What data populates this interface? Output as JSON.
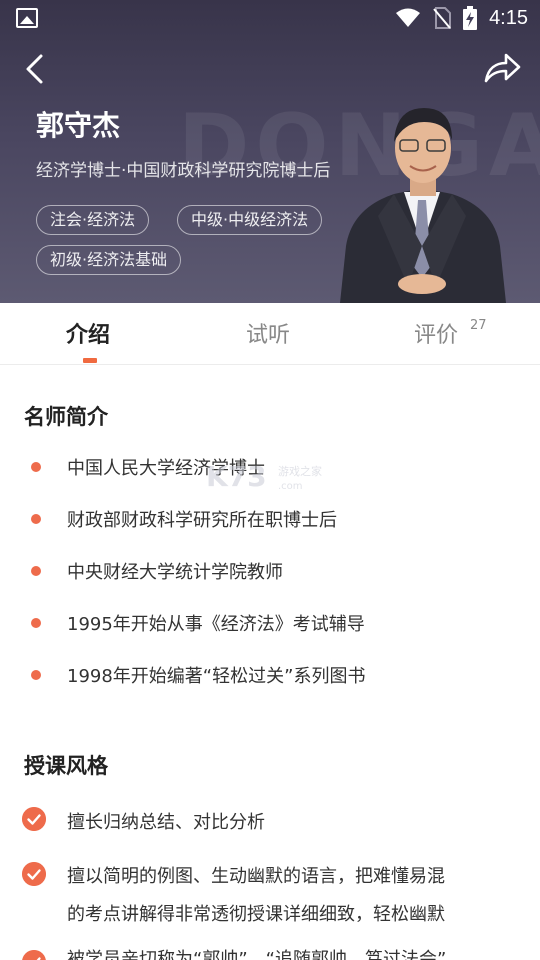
{
  "status_bar": {
    "time": "4:15"
  },
  "hero": {
    "watermark_text": "DONGAO",
    "name": "郭守杰",
    "title": "经济学博士·中国财政科学研究院博士后",
    "tags": [
      "注会·经济法",
      "中级·中级经济法",
      "初级·经济法基础"
    ]
  },
  "tabs": [
    {
      "label": "介绍"
    },
    {
      "label": "试听"
    },
    {
      "label": "评价",
      "count": "27"
    }
  ],
  "intro": {
    "title": "名师简介",
    "items": [
      "中国人民大学经济学博士",
      "财政部财政科学研究所在职博士后",
      "中央财经大学统计学院教师",
      "1995年开始从事《经济法》考试辅导",
      "1998年开始编著“轻松过关”系列图书"
    ]
  },
  "teaching_style": {
    "title": "授课风格",
    "items": [
      "擅长归纳总结、对比分析",
      "擅以简明的例图、生动幽默的语言，把难懂易混",
      "的考点讲解得非常透彻授课详细细致，轻松幽默",
      "被学员亲切称为“郭帅”，“追随郭帅，笃过法会”"
    ]
  },
  "watermark": {
    "brand": "K73",
    "site": "游戏之家",
    "domain": ".com"
  },
  "colors": {
    "accent": "#ee6b4b",
    "hero_bg": "#44405a"
  },
  "icons": [
    "image-icon",
    "wifi-icon",
    "no-sim-icon",
    "battery-charging-icon",
    "back-arrow-icon",
    "share-icon",
    "check-icon"
  ]
}
